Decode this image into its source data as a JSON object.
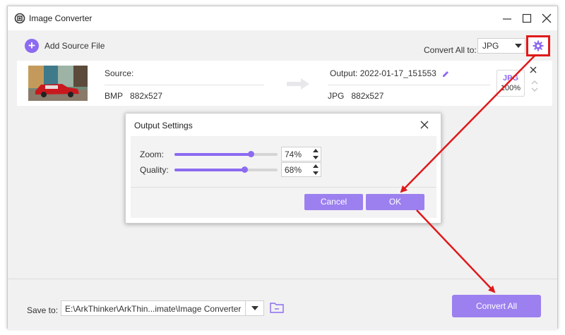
{
  "window": {
    "title": "Image Converter"
  },
  "toolbar": {
    "add_label": "Add Source File",
    "convert_all_label": "Convert All to:",
    "format_value": "JPG"
  },
  "file": {
    "source_label": "Source:",
    "source_format": "BMP",
    "source_size": "882x527",
    "output_label": "Output: 2022-01-17_151553",
    "output_format": "JPG",
    "output_size": "882x527",
    "quality_format": "JPG",
    "quality_value": "100%"
  },
  "dialog": {
    "title": "Output Settings",
    "zoom_label": "Zoom:",
    "zoom_value": "74%",
    "zoom_level": 0.74,
    "quality_label": "Quality:",
    "quality_value": "68%",
    "quality_level": 0.68,
    "cancel_label": "Cancel",
    "ok_label": "OK"
  },
  "footer": {
    "save_label": "Save to:",
    "path": "E:\\ArkThinker\\ArkThin...imate\\Image Converter",
    "convert_label": "Convert All"
  },
  "colors": {
    "accent": "#8c6af1",
    "button": "#9c80ef",
    "highlight": "#e0191b"
  },
  "icons": [
    "app-icon",
    "minimize-icon",
    "maximize-icon",
    "close-icon",
    "plus-icon",
    "settings-gear-icon",
    "arrow-right-icon",
    "edit-pencil-icon",
    "chevron-up-icon",
    "chevron-down-icon",
    "folder-icon"
  ]
}
